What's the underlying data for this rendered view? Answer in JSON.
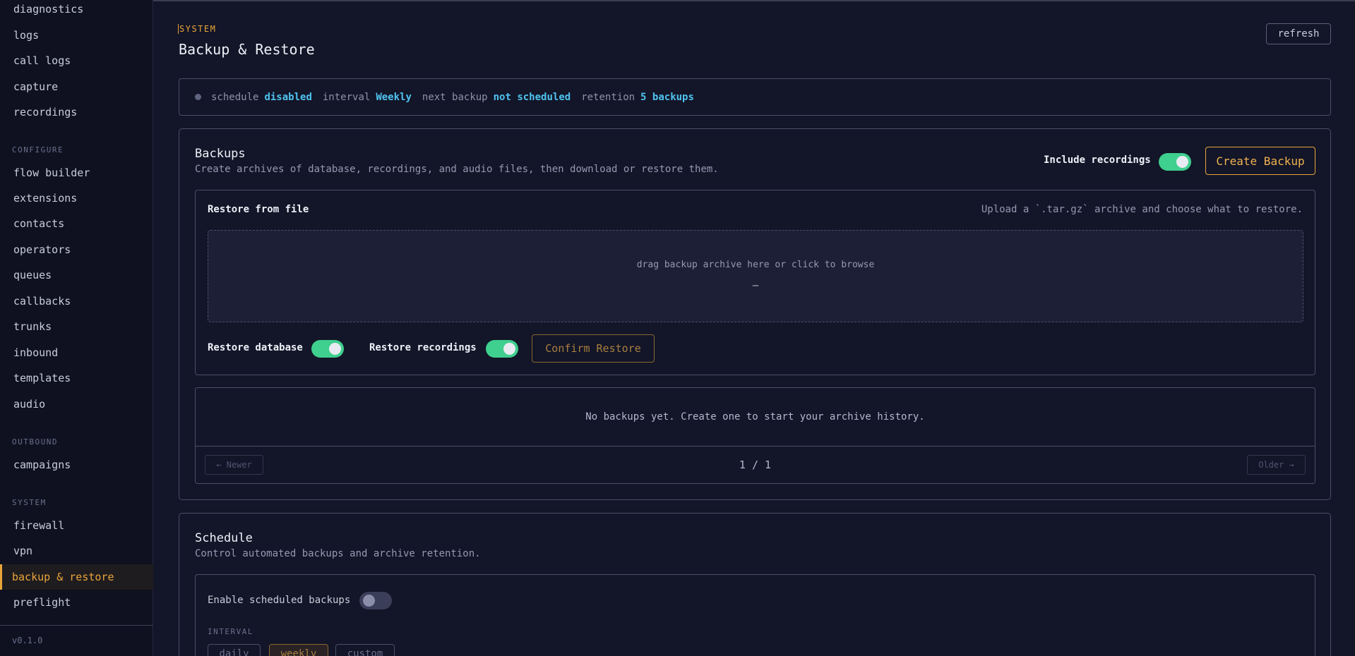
{
  "sidebar": {
    "items_top": [
      "diagnostics",
      "logs",
      "call logs",
      "capture",
      "recordings"
    ],
    "section_configure": "CONFIGURE",
    "items_configure": [
      "flow builder",
      "extensions",
      "contacts",
      "operators",
      "queues",
      "callbacks",
      "trunks",
      "inbound",
      "templates",
      "audio"
    ],
    "section_outbound": "OUTBOUND",
    "items_outbound": [
      "campaigns"
    ],
    "section_system": "SYSTEM",
    "items_system": [
      "firewall",
      "vpn",
      "backup & restore",
      "preflight"
    ],
    "active_item": "backup & restore",
    "version": "v0.1.0"
  },
  "header": {
    "eyebrow": "SYSTEM",
    "title": "Backup & Restore",
    "refresh_label": "refresh"
  },
  "status": {
    "schedule_label": "schedule",
    "schedule_value": "disabled",
    "interval_label": "interval",
    "interval_value": "Weekly",
    "next_label": "next backup",
    "next_value": "not scheduled",
    "retention_label": "retention",
    "retention_value": "5 backups"
  },
  "backups": {
    "title": "Backups",
    "subtitle": "Create archives of database, recordings, and audio files, then download or restore them.",
    "include_recordings_label": "Include recordings",
    "include_recordings_on": true,
    "create_label": "Create Backup",
    "restore": {
      "title": "Restore from file",
      "hint": "Upload a `.tar.gz` archive and choose what to restore.",
      "dropzone_text": "drag backup archive here or click to browse",
      "dropzone_file": "—",
      "restore_db_label": "Restore database",
      "restore_db_on": true,
      "restore_rec_label": "Restore recordings",
      "restore_rec_on": true,
      "confirm_label": "Confirm Restore"
    },
    "list": {
      "empty_text": "No backups yet. Create one to start your archive history.",
      "newer_label": "← Newer",
      "older_label": "Older →",
      "page_info": "1 / 1"
    }
  },
  "schedule": {
    "title": "Schedule",
    "subtitle": "Control automated backups and archive retention.",
    "enable_label": "Enable scheduled backups",
    "enable_on": false,
    "interval_heading": "INTERVAL",
    "interval_options": [
      "daily",
      "weekly",
      "custom"
    ],
    "interval_selected": "weekly"
  },
  "colors": {
    "accent": "#e9a53a",
    "highlight": "#4fc3ef",
    "toggle_on": "#3fcf8e",
    "background": "#131528"
  }
}
